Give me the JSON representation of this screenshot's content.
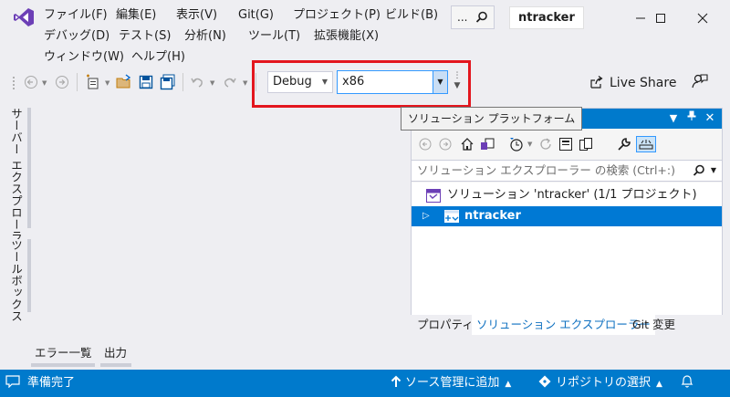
{
  "menu": {
    "items": [
      "ファイル(F)",
      "編集(E)",
      "表示(V)",
      "Git(G)",
      "プロジェクト(P)",
      "ビルド(B)",
      "デバッグ(D)",
      "テスト(S)",
      "分析(N)",
      "ツール(T)",
      "拡張機能(X)",
      "ウィンドウ(W)",
      "ヘルプ(H)"
    ]
  },
  "search": {
    "label": "..."
  },
  "solution_name": "ntracker",
  "toolbar": {
    "config": "Debug",
    "platform": "x86",
    "live_share": "Live Share"
  },
  "tooltip": "ソリューション プラットフォーム",
  "left_tabs": [
    "サーバー エクスプローラー",
    "ツールボックス"
  ],
  "solution_explorer": {
    "search_placeholder": "ソリューション エクスプローラー の検索 (Ctrl+:)",
    "solution_node": "ソリューション 'ntracker' (1/1 プロジェクト)",
    "project_node": "ntracker",
    "tabs": [
      "プロパティ",
      "ソリューション エクスプローラー",
      "Git 変更"
    ]
  },
  "bottom_tabs": [
    "エラー一覧",
    "出力"
  ],
  "status_bar": {
    "ready": "準備完了",
    "source_control": "ソース管理に追加",
    "repository": "リポジトリの選択"
  },
  "colors": {
    "accent": "#007acc",
    "highlight": "#e3161e",
    "selection": "#0079d4"
  }
}
